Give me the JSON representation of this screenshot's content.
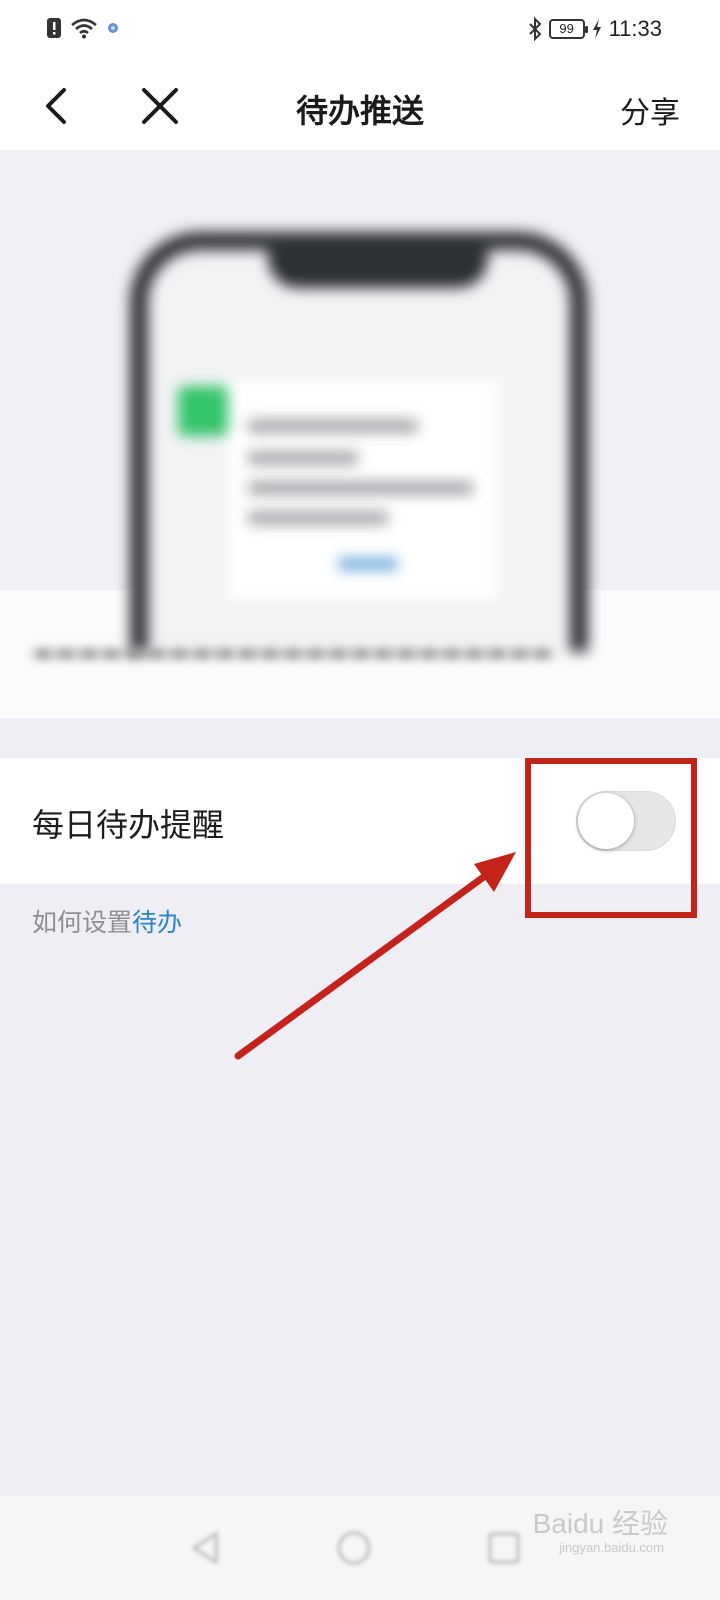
{
  "status_bar": {
    "time": "11:33",
    "battery": "99",
    "icons": [
      "alert-icon",
      "wifi-icon",
      "app-notification-icon",
      "bluetooth-icon",
      "charging-icon"
    ]
  },
  "nav": {
    "title": "待办推送",
    "share_label": "分享",
    "icons": [
      "back-icon",
      "close-icon"
    ]
  },
  "settings": {
    "daily_reminder_label": "每日待办提醒",
    "daily_reminder_enabled": false
  },
  "help": {
    "prefix": "如何设置",
    "link": "待办"
  },
  "watermark": {
    "brand": "Baidu 经验",
    "url": "jingyan.baidu.com"
  },
  "colors": {
    "accent_link": "#2b86c6",
    "annotation_red": "#c3231b",
    "background": "#efeef4"
  }
}
